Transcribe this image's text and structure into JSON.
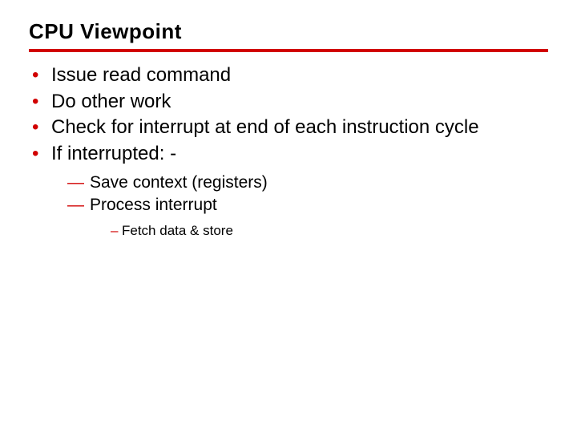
{
  "title": "CPU Viewpoint",
  "bullets": {
    "b0": "Issue read command",
    "b1": "Do other work",
    "b2": "Check for interrupt at end of each instruction cycle",
    "b3": "If interrupted: -"
  },
  "sub": {
    "s0": "Save context (registers)",
    "s1": "Process interrupt"
  },
  "subsub": {
    "t0": "Fetch data & store"
  }
}
